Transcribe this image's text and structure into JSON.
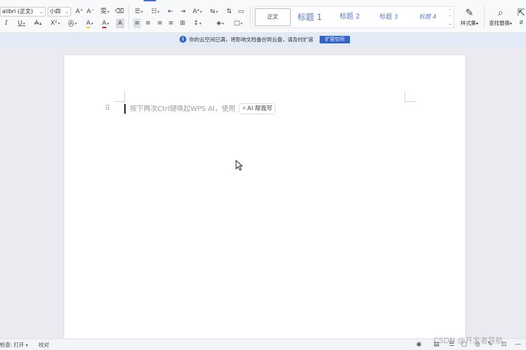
{
  "ribbon": {
    "font_name": "alibri (正文)",
    "font_size": "小四",
    "row1_buttons": [
      "A⁺",
      "A⁻",
      "雯",
      "⌫"
    ],
    "row2_buttons": [
      "I",
      "U",
      "A",
      "X²",
      "A",
      "A",
      "A"
    ],
    "gallery": {
      "items": [
        "正文",
        "标题 1",
        "标题 2",
        "标题 3",
        "标题 4"
      ]
    },
    "styles_label": "样式集",
    "find_replace_label": "查找替换"
  },
  "notice": {
    "message": "你的云空间已满，将影响文档备份到云盘，请及时扩容",
    "button": "扩容空间"
  },
  "document": {
    "placeholder": "按下两次Ctrl键唤起WPS AI，使用",
    "ai_chip": "AI 帮我写"
  },
  "statusbar": {
    "spellcheck": "检查: 打开",
    "proofread": "校对"
  },
  "watermark": "CSDN @开发者导航",
  "colors": {
    "accent": "#3564c9",
    "highlight": "#f5d22b",
    "font_color": "#c8262b"
  }
}
